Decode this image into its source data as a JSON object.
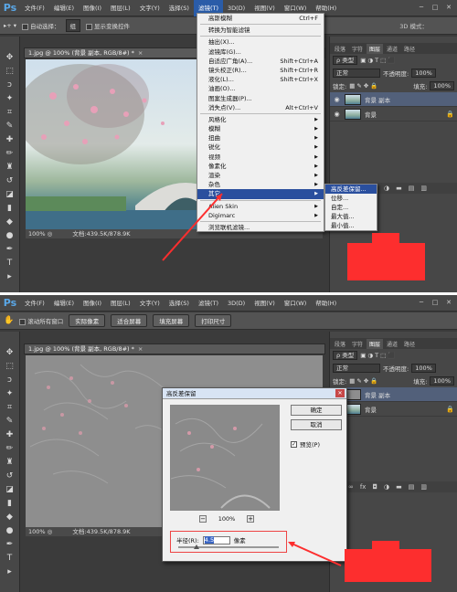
{
  "top": {
    "app_logo": "Ps",
    "menu": [
      "文件(F)",
      "编辑(E)",
      "图像(I)",
      "图层(L)",
      "文字(Y)",
      "选择(S)",
      "滤镜(T)",
      "3D(D)",
      "视图(V)",
      "窗口(W)",
      "帮助(H)"
    ],
    "options": {
      "auto_select_label": "自动选择：",
      "auto_select_value": "组",
      "show_transform_label": "显示变换控件",
      "mode_3d": "3D 模式："
    },
    "doc_tab": "1.jpg @ 100% (背景 副本, RGB/8#) *",
    "status_zoom": "100%",
    "status_doc": "文档:439.5K/878.9K",
    "filter_menu": {
      "items": [
        {
          "label": "高斯模糊",
          "shortcut": "Ctrl+F"
        },
        {
          "sep": true
        },
        {
          "label": "转换为智能滤镜",
          "shortcut": ""
        },
        {
          "sep": true
        },
        {
          "label": "抽出(X)...",
          "shortcut": ""
        },
        {
          "label": "滤镜库(G)...",
          "shortcut": ""
        },
        {
          "label": "自适应广角(A)...",
          "shortcut": "Shift+Ctrl+A"
        },
        {
          "label": "镜头校正(R)...",
          "shortcut": "Shift+Ctrl+R"
        },
        {
          "label": "液化(L)...",
          "shortcut": "Shift+Ctrl+X"
        },
        {
          "label": "油画(O)...",
          "shortcut": ""
        },
        {
          "label": "图案生成器(P)...",
          "shortcut": ""
        },
        {
          "label": "消失点(V)...",
          "shortcut": "Alt+Ctrl+V"
        },
        {
          "sep": true
        },
        {
          "label": "风格化",
          "shortcut": "▶"
        },
        {
          "label": "模糊",
          "shortcut": "▶"
        },
        {
          "label": "扭曲",
          "shortcut": "▶"
        },
        {
          "label": "锐化",
          "shortcut": "▶"
        },
        {
          "label": "视频",
          "shortcut": "▶"
        },
        {
          "label": "像素化",
          "shortcut": "▶"
        },
        {
          "label": "渲染",
          "shortcut": "▶"
        },
        {
          "label": "杂色",
          "shortcut": "▶"
        },
        {
          "label": "其它",
          "shortcut": "▶",
          "highlight": true
        },
        {
          "sep": true
        },
        {
          "label": "Alien Skin",
          "shortcut": "▶"
        },
        {
          "label": "Digimarc",
          "shortcut": "▶"
        },
        {
          "sep": true
        },
        {
          "label": "浏览联机滤镜...",
          "shortcut": ""
        }
      ]
    },
    "submenu": [
      {
        "label": "高反差保留...",
        "highlight": true
      },
      {
        "label": "位移..."
      },
      {
        "label": "自定..."
      },
      {
        "label": "最大值..."
      },
      {
        "label": "最小值..."
      }
    ],
    "panel_tabs": [
      "段落",
      "字符",
      "图层",
      "通道",
      "路径"
    ],
    "layers": {
      "kind": "ρ 类型",
      "blend": "正常",
      "opacity_label": "不透明度:",
      "opacity_value": "100%",
      "lock_label": "锁定:",
      "fill_label": "填充:",
      "fill_value": "100%",
      "items": [
        {
          "name": "背景 副本",
          "active": true
        },
        {
          "name": "背景",
          "active": false
        }
      ]
    }
  },
  "bottom": {
    "app_logo": "Ps",
    "menu": [
      "文件(F)",
      "编辑(E)",
      "图像(I)",
      "图层(L)",
      "文字(Y)",
      "选择(S)",
      "滤镜(T)",
      "3D(D)",
      "视图(V)",
      "窗口(W)",
      "帮助(H)"
    ],
    "options": {
      "scroll_all_label": "滚动所有窗口",
      "actual_pixels": "实际像素",
      "fit_screen": "适合屏幕",
      "fill_screen": "填充屏幕",
      "print_size": "打印尺寸"
    },
    "doc_tab": "1.jpg @ 100% (背景 副本, RGB/8#) *",
    "status_zoom": "100%",
    "status_doc": "文档:439.5K/878.9K",
    "dialog": {
      "title": "高反差保留",
      "ok": "确定",
      "cancel": "取消",
      "preview_label": "预览(P)",
      "zoom": "100%",
      "radius_label": "半径(R):",
      "radius_value": "4.5",
      "radius_unit": "像素",
      "slider_fraction": 0.18
    },
    "panel_tabs": [
      "段落",
      "字符",
      "图层",
      "通道",
      "路径"
    ],
    "layers": {
      "kind": "ρ 类型",
      "blend": "正常",
      "opacity_label": "不透明度:",
      "opacity_value": "100%",
      "lock_label": "锁定:",
      "fill_label": "填充:",
      "fill_value": "100%",
      "items": [
        {
          "name": "背景 副本",
          "active": true
        },
        {
          "name": "背景",
          "active": false
        }
      ]
    }
  },
  "colors": {
    "annotation_red": "#fd2e2e",
    "menu_highlight": "#2a4f9e"
  }
}
